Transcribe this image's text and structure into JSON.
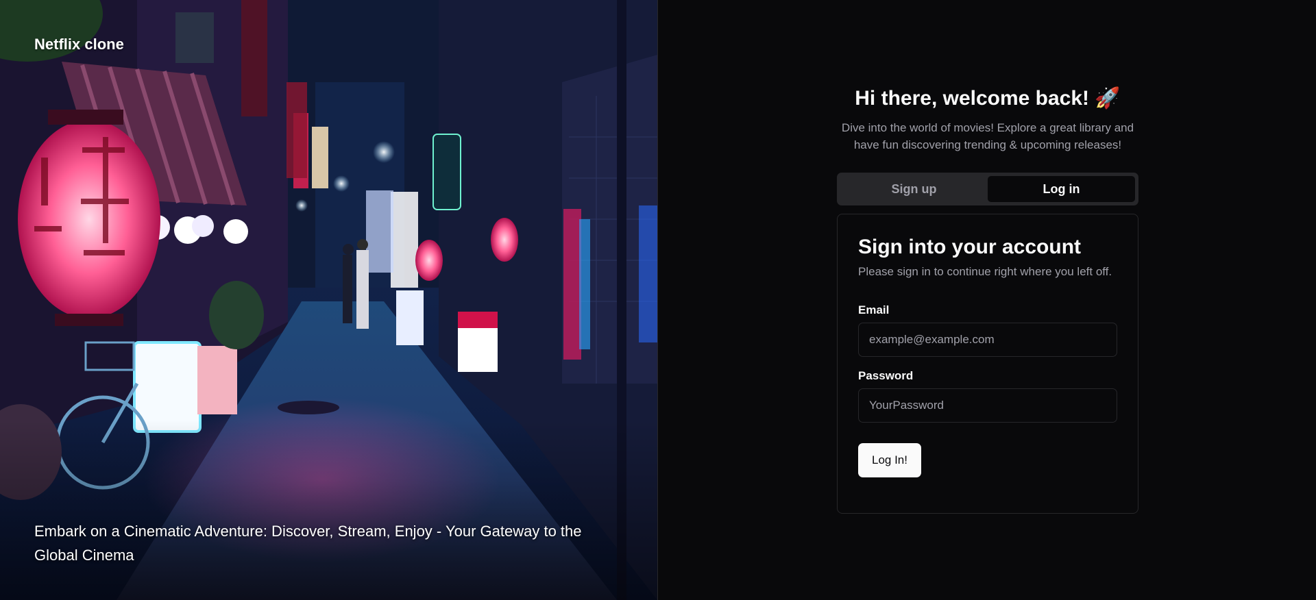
{
  "app": {
    "brand": "Netflix clone"
  },
  "hero": {
    "tagline": "Embark on a Cinematic Adventure: Discover, Stream, Enjoy - Your Gateway to the Global Cinema",
    "image_description_icon": "night-alley-photo"
  },
  "auth": {
    "welcome_title": "Hi there, welcome back! 🚀",
    "welcome_subtitle": "Dive into the world of movies! Explore a great library and have fun discovering trending & upcoming releases!",
    "tabs": [
      {
        "label": "Sign up",
        "active": false
      },
      {
        "label": "Log in",
        "active": true
      }
    ],
    "card": {
      "title": "Sign into your account",
      "subtitle": "Please sign in to continue right where you left off.",
      "email_label": "Email",
      "email_placeholder": "example@example.com",
      "email_value": "",
      "password_label": "Password",
      "password_placeholder": "YourPassword",
      "password_value": "",
      "submit_label": "Log In!"
    }
  },
  "colors": {
    "background": "#09090b",
    "border": "#27272a",
    "muted_text": "#a1a1aa",
    "foreground": "#fafafa",
    "tab_track": "#27272a"
  }
}
